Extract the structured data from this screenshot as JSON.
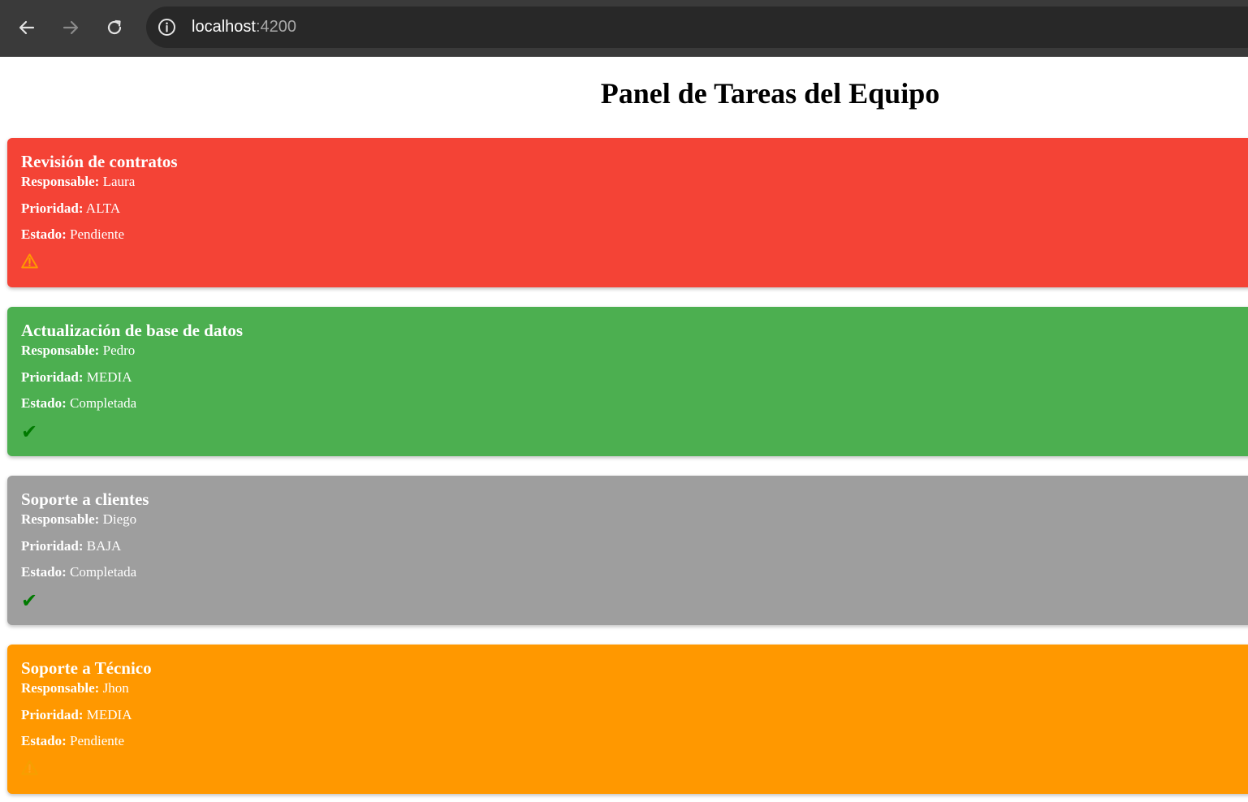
{
  "browser": {
    "url_host": "localhost",
    "url_port": ":4200"
  },
  "page": {
    "title": "Panel de Tareas del Equipo"
  },
  "labels": {
    "responsable": "Responsable:",
    "prioridad": "Prioridad:",
    "estado": "Estado:"
  },
  "tasks": [
    {
      "title": "Revisión de contratos",
      "responsable": " Laura",
      "prioridad": " ALTA",
      "estado": " Pendiente",
      "status_icon": "warning-icon",
      "color": "#f44336"
    },
    {
      "title": "Actualización de base de datos",
      "responsable": " Pedro",
      "prioridad": " MEDIA",
      "estado": " Completada",
      "status_icon": "check-icon",
      "color": "#4caf50"
    },
    {
      "title": "Soporte a clientes",
      "responsable": " Diego",
      "prioridad": " BAJA",
      "estado": " Completada",
      "status_icon": "check-icon",
      "color": "#9e9e9e"
    },
    {
      "title": "Soporte a Técnico",
      "responsable": " Jhon",
      "prioridad": " MEDIA",
      "estado": " Pendiente",
      "status_icon": "warning-icon",
      "color": "#ff9800"
    }
  ]
}
